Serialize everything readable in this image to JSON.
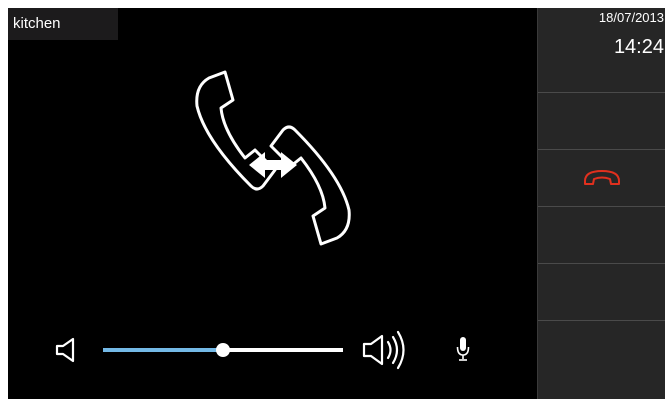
{
  "location": {
    "name": "kitchen"
  },
  "status": {
    "date": "18/07/2013",
    "time": "14:24"
  },
  "call": {
    "state_icon": "intercom-call-active-icon"
  },
  "volume": {
    "level": 0.5,
    "low_icon": "speaker-low-icon",
    "high_icon": "speaker-high-icon"
  },
  "microphone": {
    "icon": "microphone-icon"
  },
  "sidebar": {
    "buttons": [
      {
        "name": "empty-slot-1"
      },
      {
        "name": "hangup",
        "icon": "hangup-icon",
        "color": "#e0301e"
      },
      {
        "name": "empty-slot-2"
      },
      {
        "name": "empty-slot-3"
      },
      {
        "name": "empty-slot-4"
      }
    ]
  },
  "colors": {
    "screen_background": "#000000",
    "sidebar_background": "#262626",
    "slider_fill": "#74b9e6",
    "slider_track": "#ffffff",
    "hangup": "#e0301e"
  }
}
